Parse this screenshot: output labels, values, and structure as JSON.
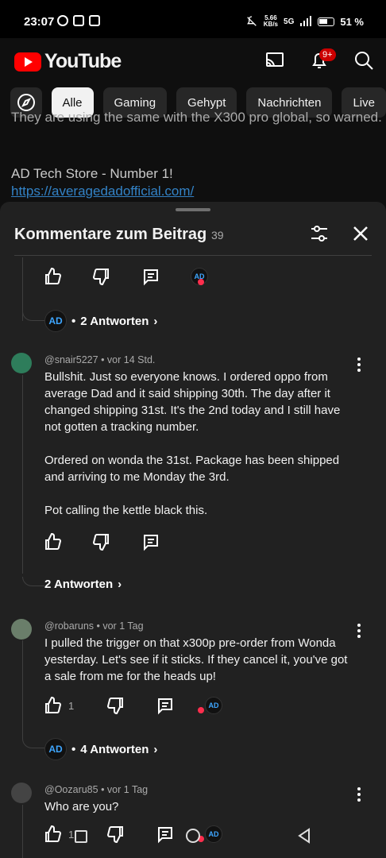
{
  "status_bar": {
    "time": "23:07",
    "network_speed": "5.66\nKB/s",
    "network_type": "5G",
    "battery": "51 %"
  },
  "header": {
    "brand": "YouTube",
    "notification_badge": "9+"
  },
  "chips": [
    "Alle",
    "Gaming",
    "Gehypt",
    "Nachrichten",
    "Live"
  ],
  "description": {
    "clipped_line": "They are using the same with the X300 pro global, so warned.",
    "store": "AD Tech Store - Number 1!",
    "link": "https://averagedadofficial.com/"
  },
  "comments_sheet": {
    "title": "Kommentare zum Beitrag",
    "count": "39",
    "first_thread": {
      "replies": "2 Antworten"
    },
    "comments": [
      {
        "author": "@snair5227",
        "time": "vor 14 Std.",
        "body": "Bullshit. Just so everyone knows. I ordered oppo from average Dad and it said shipping 30th. The day after it changed shipping 31st. It's the 2nd today and I still have not gotten a tracking number.\n\nOrdered on wonda the 31st. Package has been shipped and arriving to me Monday the 3rd.\n\nPot calling the kettle black this.",
        "like_count": "",
        "replies": "2 Antworten"
      },
      {
        "author": "@robaruns",
        "time": "vor 1 Tag",
        "body": "I pulled the trigger on that x300p pre-order from Wonda yesterday. Let's see if it sticks. If they cancel it, you've got a sale from me for the heads up!",
        "like_count": "1",
        "replies": "4 Antworten"
      },
      {
        "author": "@Oozaru85",
        "time": "vor 1 Tag",
        "body": "Who are you?",
        "like_count": "1",
        "replies": ""
      }
    ]
  },
  "icons": {
    "like": "thumb-up-icon",
    "dislike": "thumb-down-icon",
    "reply": "comment-icon",
    "heart": "heart-icon"
  },
  "colors": {
    "accent": "#ff0000",
    "link": "#3ea6ff",
    "background": "#0f0f0f",
    "sheet": "#212121"
  }
}
